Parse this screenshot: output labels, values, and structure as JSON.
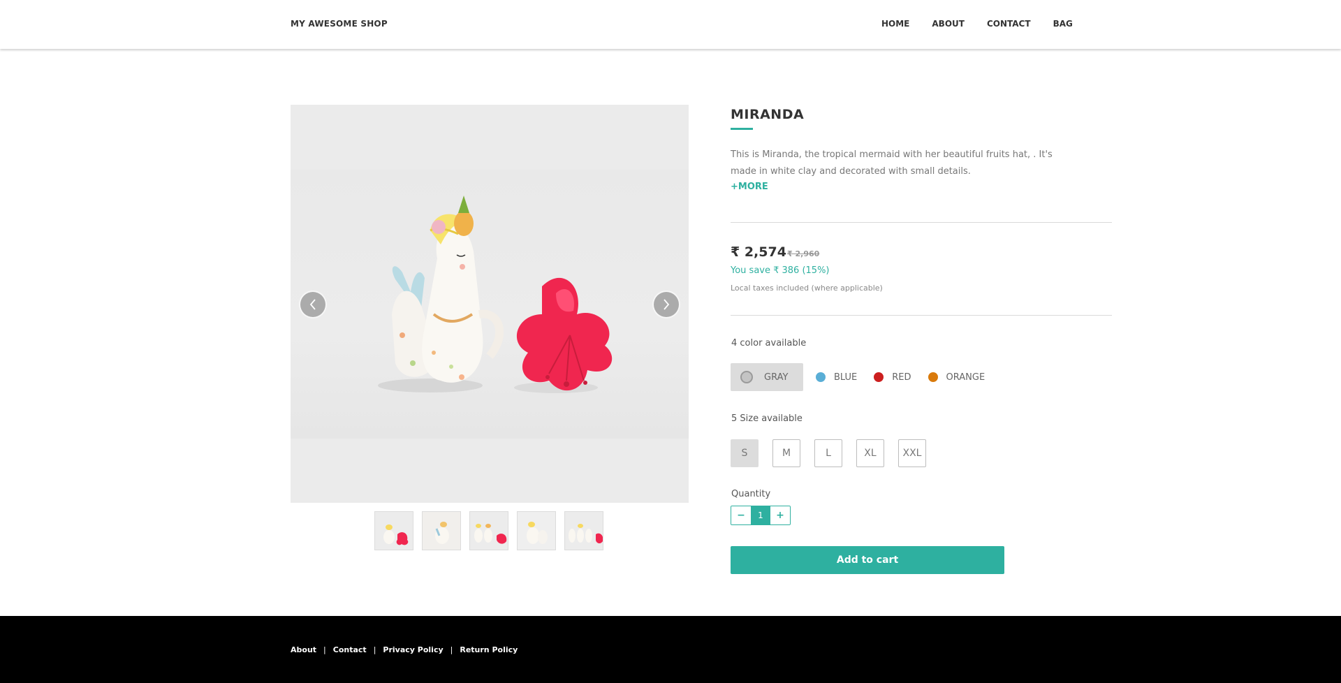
{
  "header": {
    "brand": "MY AWESOME SHOP",
    "nav": [
      "HOME",
      "ABOUT",
      "CONTACT",
      "BAG"
    ]
  },
  "product": {
    "title": "MIRANDA",
    "description": "This is Miranda, the tropical mermaid with her beautiful fruits hat, . It's made in white clay and decorated with small details.",
    "more_label": "+MORE",
    "price": "₹ 2,574",
    "old_price": "₹ 2,960",
    "savings": "You save ₹ 386 (15%)",
    "tax_note": "Local taxes included (where applicable)",
    "colors_label": "4 color available",
    "colors": [
      {
        "name": "GRAY",
        "hex": "#c4c4c4",
        "selected": true
      },
      {
        "name": "BLUE",
        "hex": "#5aaed6",
        "selected": false
      },
      {
        "name": "RED",
        "hex": "#cc1f1f",
        "selected": false
      },
      {
        "name": "ORANGE",
        "hex": "#d97a0b",
        "selected": false
      }
    ],
    "sizes_label": "5 Size available",
    "sizes": [
      "S",
      "M",
      "L",
      "XL",
      "XXL"
    ],
    "selected_size": "S",
    "quantity_label": "Quantity",
    "quantity": "1",
    "quantity_decrement": "−",
    "quantity_increment": "+",
    "add_to_cart": "Add to cart"
  },
  "gallery": {
    "thumbnail_count": 5
  },
  "footer": {
    "links": [
      "About",
      "Contact",
      "Privacy Policy",
      "Return Policy"
    ],
    "separator": "|"
  },
  "colors": {
    "accent": "#2eb0a0",
    "footer_bg": "#000000"
  }
}
